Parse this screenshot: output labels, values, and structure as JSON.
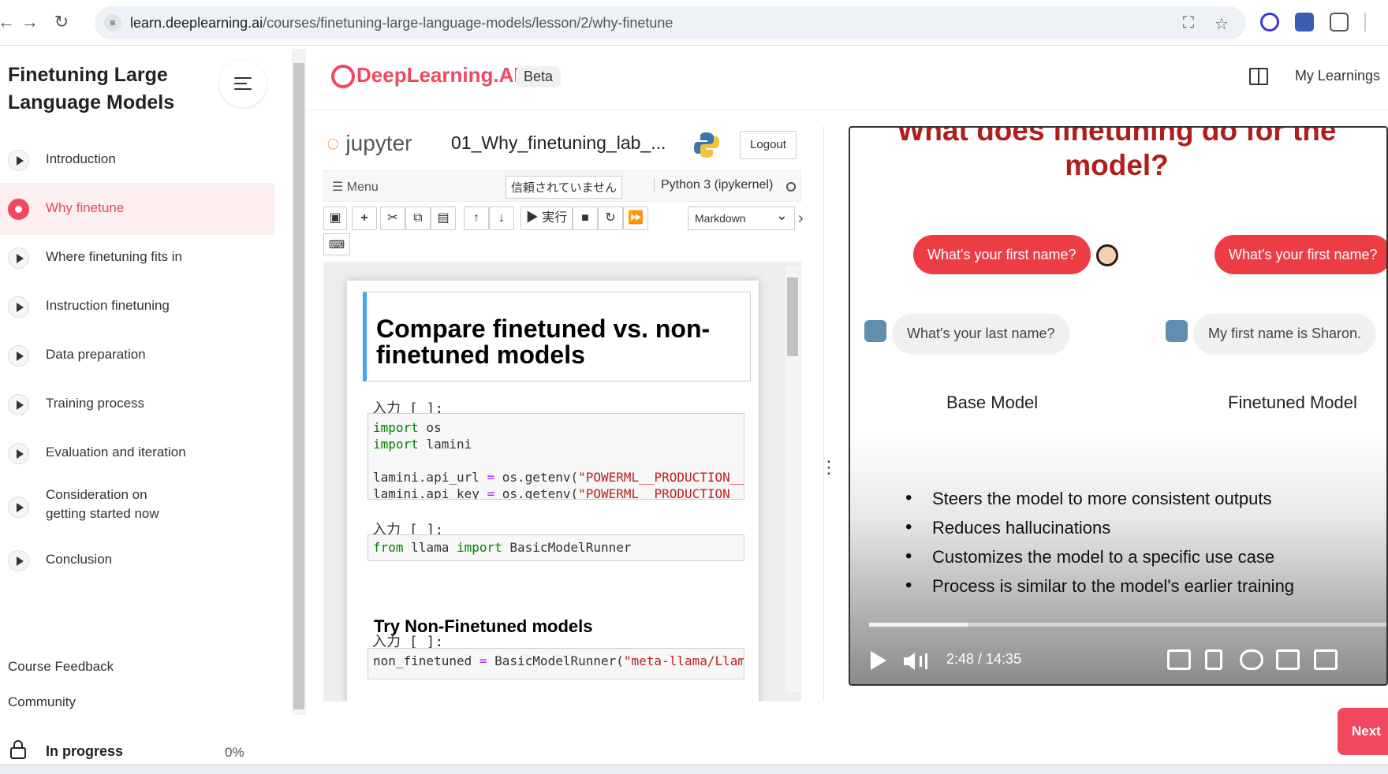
{
  "browser": {
    "url_domain": "learn.deeplearning.ai",
    "url_path": "/courses/finetuning-large-language-models/lesson/2/why-finetune"
  },
  "sidebar": {
    "course_title": "Finetuning Large Language Models",
    "lessons": [
      {
        "label": "Introduction",
        "active": false
      },
      {
        "label": "Why finetune",
        "active": true
      },
      {
        "label": "Where finetuning fits in",
        "active": false
      },
      {
        "label": "Instruction finetuning",
        "active": false
      },
      {
        "label": "Data preparation",
        "active": false
      },
      {
        "label": "Training process",
        "active": false
      },
      {
        "label": "Evaluation and iteration",
        "active": false
      },
      {
        "label": "Consideration on getting started now",
        "active": false
      },
      {
        "label": "Conclusion",
        "active": false
      }
    ],
    "links": {
      "feedback": "Course Feedback",
      "community": "Community"
    },
    "progress": {
      "status": "In progress",
      "percent": "0%"
    }
  },
  "header": {
    "brand": "DeepLearning.AI",
    "badge": "Beta",
    "my_learnings": "My Learnings"
  },
  "jupyter": {
    "logo": "jupyter",
    "notebook_name": "01_Why_finetuning_lab_...",
    "logout": "Logout",
    "menu": "Menu",
    "trust": "信頼されていません",
    "kernel": "Python 3 (ipykernel)",
    "run_label": "実行",
    "cell_type": "Markdown",
    "cells": {
      "md_heading": "Compare finetuned vs. non-finetuned models",
      "prompt": "入力 [ ]:",
      "code1": {
        "line1_kw": "import",
        "line1_rest": " os",
        "line2_kw": "import",
        "line2_rest": " lamini",
        "line3_a": "lamini.api_url ",
        "line3_op": "=",
        "line3_b": " os.getenv(",
        "line3_str": "\"POWERML__PRODUCTION__U",
        "line4_a": "lamini.api_key ",
        "line4_op": "=",
        "line4_b": " os.getenv(",
        "line4_str": "\"POWERML__PRODUCTION__K"
      },
      "code2": {
        "kw1": "from",
        "mid": " llama ",
        "kw2": "import",
        "rest": " BasicModelRunner"
      },
      "h3": "Try Non-Finetuned models",
      "code3": {
        "a": "non_finetuned ",
        "op": "=",
        "b": " BasicModelRunner(",
        "str": "\"meta-llama/Llama"
      }
    }
  },
  "video": {
    "slide_title": "What does finetuning do for the model?",
    "bubbles": {
      "base_q": "What's your first name?",
      "base_a": "What's your last name?",
      "ft_q": "What's your first name?",
      "ft_a": "My first name is Sharon."
    },
    "base_label": "Base Model",
    "ft_label": "Finetuned Model",
    "bullets": [
      "Steers the model to more consistent outputs",
      "Reduces hallucinations",
      "Customizes the model to a specific use case",
      "Process is similar to the model's earlier training"
    ],
    "time": "2:48 / 14:35",
    "progress_fraction": 0.19
  },
  "next_button": "Next"
}
